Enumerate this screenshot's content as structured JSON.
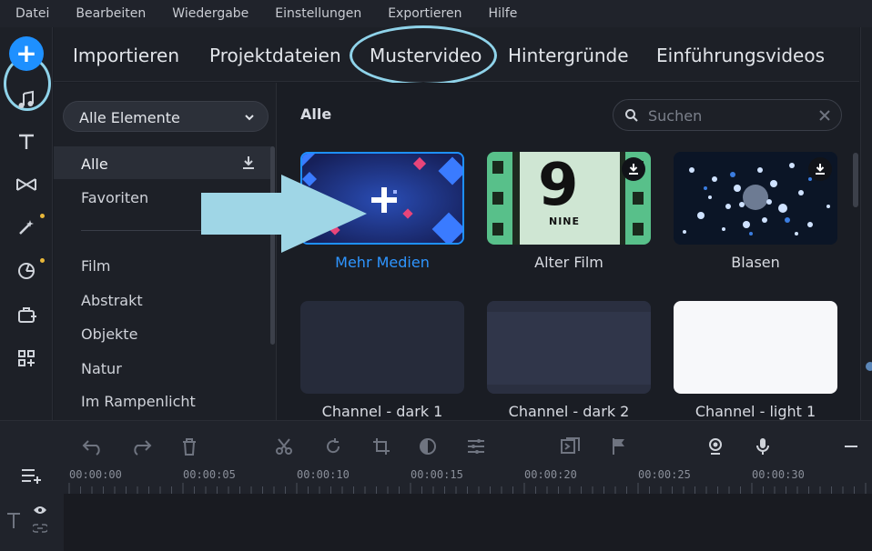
{
  "menu": [
    "Datei",
    "Bearbeiten",
    "Wiedergabe",
    "Einstellungen",
    "Exportieren",
    "Hilfe"
  ],
  "sidebar_icons": [
    "add-media-icon",
    "music-icon",
    "text-icon",
    "transitions-icon",
    "effects-icon",
    "stickers-icon",
    "stock-icon",
    "more-tools-icon"
  ],
  "tabs": [
    "Importieren",
    "Projektdateien",
    "Mustervideo",
    "Hintergründe",
    "Einführungsvideos"
  ],
  "active_tab": "Mustervideo",
  "filter_dropdown": "Alle Elemente",
  "categories": {
    "top": [
      "Alle",
      "Favoriten"
    ],
    "list": [
      "Film",
      "Abstrakt",
      "Objekte",
      "Natur",
      "Im Rampenlicht"
    ]
  },
  "section_title": "Alle",
  "search": {
    "placeholder": "Suchen"
  },
  "items": [
    {
      "label": "Mehr Medien"
    },
    {
      "label": "Alter Film"
    },
    {
      "label": "Blasen"
    },
    {
      "label": "Channel - dark 1"
    },
    {
      "label": "Channel - dark 2"
    },
    {
      "label": "Channel - light 1"
    }
  ],
  "film_thumb_text": {
    "number": "9",
    "word": "NINE"
  },
  "timecodes": [
    "00:00:00",
    "00:00:05",
    "00:00:10",
    "00:00:15",
    "00:00:20",
    "00:00:25",
    "00:00:30"
  ],
  "colors": {
    "accent": "#1e90ff",
    "highlight_ring": "#8fd3ea",
    "arrow": "#9fd6e6",
    "badge_dot": "#e8b73a"
  }
}
